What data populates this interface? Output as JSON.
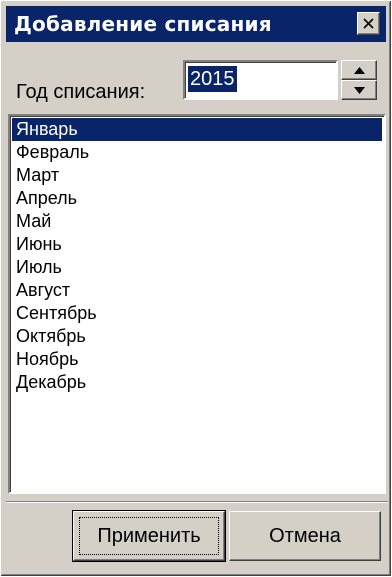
{
  "window": {
    "title": "Добавление списания"
  },
  "form": {
    "year_label": "Год списания:",
    "year_value": "2015"
  },
  "months": {
    "selected_index": 0,
    "items": [
      {
        "label": "Январь"
      },
      {
        "label": "Февраль"
      },
      {
        "label": "Март"
      },
      {
        "label": "Апрель"
      },
      {
        "label": "Май"
      },
      {
        "label": "Июнь"
      },
      {
        "label": "Июль"
      },
      {
        "label": "Август"
      },
      {
        "label": "Сентябрь"
      },
      {
        "label": "Октябрь"
      },
      {
        "label": "Ноябрь"
      },
      {
        "label": "Декабрь"
      }
    ]
  },
  "buttons": {
    "apply_label": "Применить",
    "cancel_label": "Отмена"
  },
  "icons": {
    "close": "close-icon",
    "spin_up": "arrow-up-icon",
    "spin_down": "arrow-down-icon"
  },
  "colors": {
    "titlebar": "#0a246a",
    "selection": "#0a246a",
    "face": "#d4d0c8"
  }
}
